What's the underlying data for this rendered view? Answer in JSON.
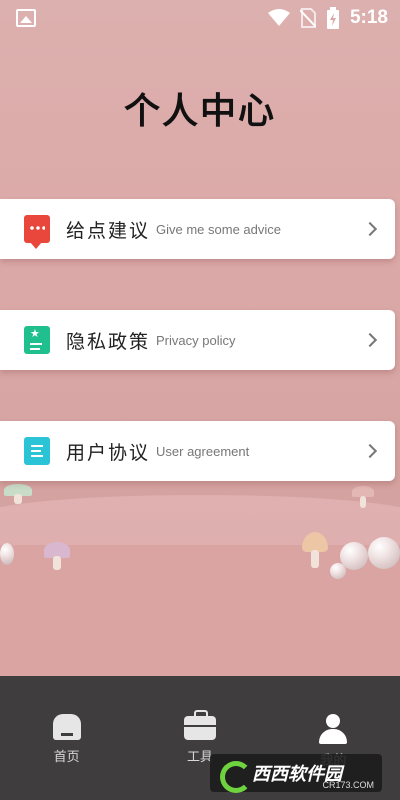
{
  "status_bar": {
    "time": "5:18"
  },
  "page_title": "个人中心",
  "menu": [
    {
      "label_cn": "给点建议",
      "label_en": "Give me some advice",
      "icon": "advice-icon",
      "color": "#e9463c"
    },
    {
      "label_cn": "隐私政策",
      "label_en": "Privacy policy",
      "icon": "privacy-icon",
      "color": "#20c08e"
    },
    {
      "label_cn": "用户协议",
      "label_en": "User agreement",
      "icon": "agreement-icon",
      "color": "#2bc3d6"
    }
  ],
  "tabbar": {
    "tabs": [
      {
        "label": "首页",
        "icon": "home-icon"
      },
      {
        "label": "工具",
        "icon": "toolbox-icon"
      },
      {
        "label": "我的",
        "icon": "user-icon",
        "active": true
      }
    ]
  },
  "watermark": {
    "text": "西西软件园",
    "site": "CR173.COM"
  },
  "colors": {
    "background": "#dba9a8",
    "tabbar": "#3f3d3d",
    "card": "#ffffff"
  }
}
